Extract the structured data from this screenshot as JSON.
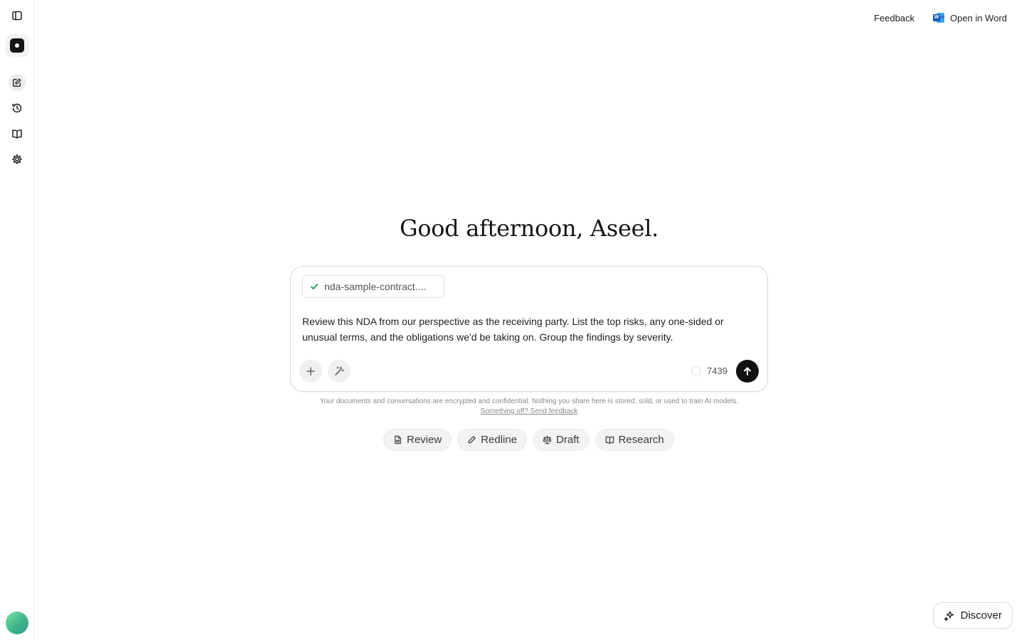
{
  "sidebar": {
    "items": [
      {
        "name": "sidebar-toggle",
        "icon": "panel-left-icon"
      },
      {
        "name": "app-logo",
        "icon": "logo-icon"
      },
      {
        "name": "new-chat",
        "icon": "edit-icon"
      },
      {
        "name": "history",
        "icon": "history-icon"
      },
      {
        "name": "library",
        "icon": "book-icon"
      },
      {
        "name": "settings",
        "icon": "gear-icon"
      }
    ]
  },
  "header": {
    "feedback_label": "Feedback",
    "open_in_word_label": "Open in Word"
  },
  "main": {
    "greeting": "Good afternoon, Aseel.",
    "composer": {
      "attachment_name": "nda-sample-contract....",
      "prompt_text": "Review this NDA from our perspective as the receiving party. List the top risks, any one-sided or unusual terms, and the obligations we'd be taking on. Group the findings by severity.",
      "counter_value": "7439"
    },
    "privacy_text": "Your documents and conversations are encrypted and confidential. Nothing you share here is stored, sold, or used to train AI models.",
    "feedback_link": "Something off? Send feedback",
    "modes": [
      {
        "label": "Review",
        "icon": "document-icon"
      },
      {
        "label": "Redline",
        "icon": "pencil-icon"
      },
      {
        "label": "Draft",
        "icon": "scale-icon"
      },
      {
        "label": "Research",
        "icon": "book-icon"
      }
    ]
  },
  "discover_label": "Discover",
  "colors": {
    "accent": "#111111",
    "check": "#2e9e5b",
    "word_blue": "#185abd"
  }
}
